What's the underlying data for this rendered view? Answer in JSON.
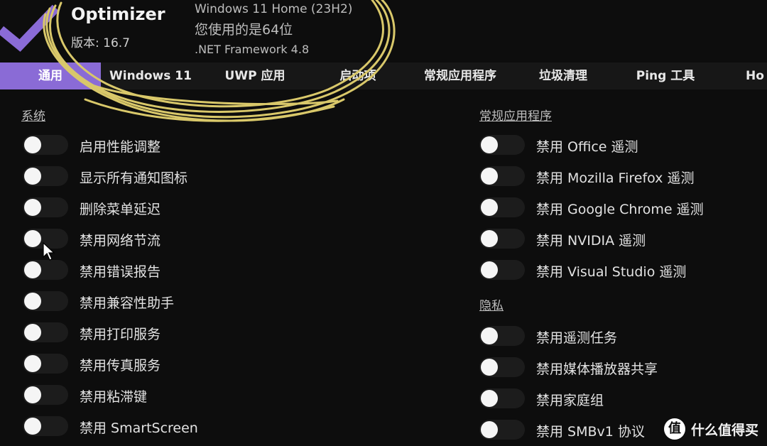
{
  "app": {
    "title": "Optimizer",
    "version": "版本: 16.7",
    "accent_color": "#8a6bd6"
  },
  "system_info": {
    "os": "Windows 11 Home (23H2)",
    "arch": "您使用的是64位",
    "framework": ".NET Framework 4.8"
  },
  "tabs": [
    {
      "label": "通用",
      "active": true
    },
    {
      "label": "Windows 11",
      "active": false
    },
    {
      "label": "UWP 应用",
      "active": false
    },
    {
      "label": "启动项",
      "active": false
    },
    {
      "label": "常规应用程序",
      "active": false
    },
    {
      "label": "垃圾清理",
      "active": false
    },
    {
      "label": "Ping 工具",
      "active": false
    },
    {
      "label": "Ho",
      "active": false
    }
  ],
  "left_section": {
    "title": "系统",
    "options": [
      {
        "label": "启用性能调整",
        "enabled": false
      },
      {
        "label": "显示所有通知图标",
        "enabled": false
      },
      {
        "label": "删除菜单延迟",
        "enabled": false
      },
      {
        "label": "禁用网络节流",
        "enabled": false
      },
      {
        "label": "禁用错误报告",
        "enabled": false
      },
      {
        "label": "禁用兼容性助手",
        "enabled": false
      },
      {
        "label": "禁用打印服务",
        "enabled": false
      },
      {
        "label": "禁用传真服务",
        "enabled": false
      },
      {
        "label": "禁用粘滞键",
        "enabled": false
      },
      {
        "label": "禁用 SmartScreen",
        "enabled": false
      }
    ]
  },
  "right_sections": [
    {
      "title": "常规应用程序",
      "options": [
        {
          "label": "禁用 Office 遥测",
          "enabled": false
        },
        {
          "label": "禁用 Mozilla Firefox 遥测",
          "enabled": false
        },
        {
          "label": "禁用 Google Chrome 遥测",
          "enabled": false
        },
        {
          "label": "禁用 NVIDIA 遥测",
          "enabled": false
        },
        {
          "label": "禁用 Visual Studio 遥测",
          "enabled": false
        }
      ]
    },
    {
      "title": "隐私",
      "options": [
        {
          "label": "禁用遥测任务",
          "enabled": false
        },
        {
          "label": "禁用媒体播放器共享",
          "enabled": false
        },
        {
          "label": "禁用家庭组",
          "enabled": false
        },
        {
          "label": "禁用 SMBv1 协议",
          "enabled": false
        }
      ]
    }
  ],
  "watermark": {
    "icon": "值",
    "text": "什么值得买"
  },
  "icons": {
    "logo": "checkmark-logo-icon",
    "cursor": "mouse-pointer-icon"
  },
  "colors": {
    "background": "#0d0d0d",
    "tab_bar": "#171717",
    "scribble": "#d9c86a",
    "toggle_track": "#1c1c1c",
    "toggle_knob": "#f5f5f5"
  }
}
